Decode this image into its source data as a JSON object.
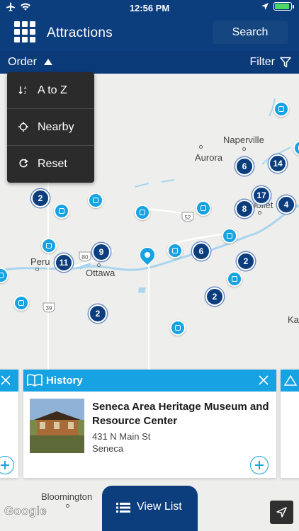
{
  "status": {
    "time": "12:56 PM",
    "battery_level": 0.9
  },
  "header": {
    "title": "Attractions",
    "search_label": "Search",
    "menu_icon": "grid-menu-icon"
  },
  "subbar": {
    "order_label": "Order",
    "filter_label": "Filter"
  },
  "order_menu": {
    "items": [
      {
        "label": "A to Z",
        "icon": "sort-az-icon"
      },
      {
        "label": "Nearby",
        "icon": "crosshair-icon"
      },
      {
        "label": "Reset",
        "icon": "reset-icon"
      }
    ]
  },
  "map": {
    "places": [
      "Naperville",
      "Aurora",
      "Joliet",
      "Peru",
      "Ottawa",
      "Bloomington",
      "Ka"
    ],
    "route_shields": [
      "52",
      "80",
      "39"
    ],
    "clusters": [
      "2",
      "6",
      "14",
      "17",
      "8",
      "4",
      "9",
      "11",
      "6",
      "2",
      "2",
      "2"
    ]
  },
  "card": {
    "category": "History",
    "title": "Seneca Area Heritage Museum and Resource Center",
    "address": "431 N Main St",
    "city": "Seneca"
  },
  "bottom": {
    "view_list_label": "View List",
    "attribution": "Google"
  },
  "colors": {
    "brand_navy": "#0c3d7c",
    "accent_blue": "#17a2e3"
  }
}
